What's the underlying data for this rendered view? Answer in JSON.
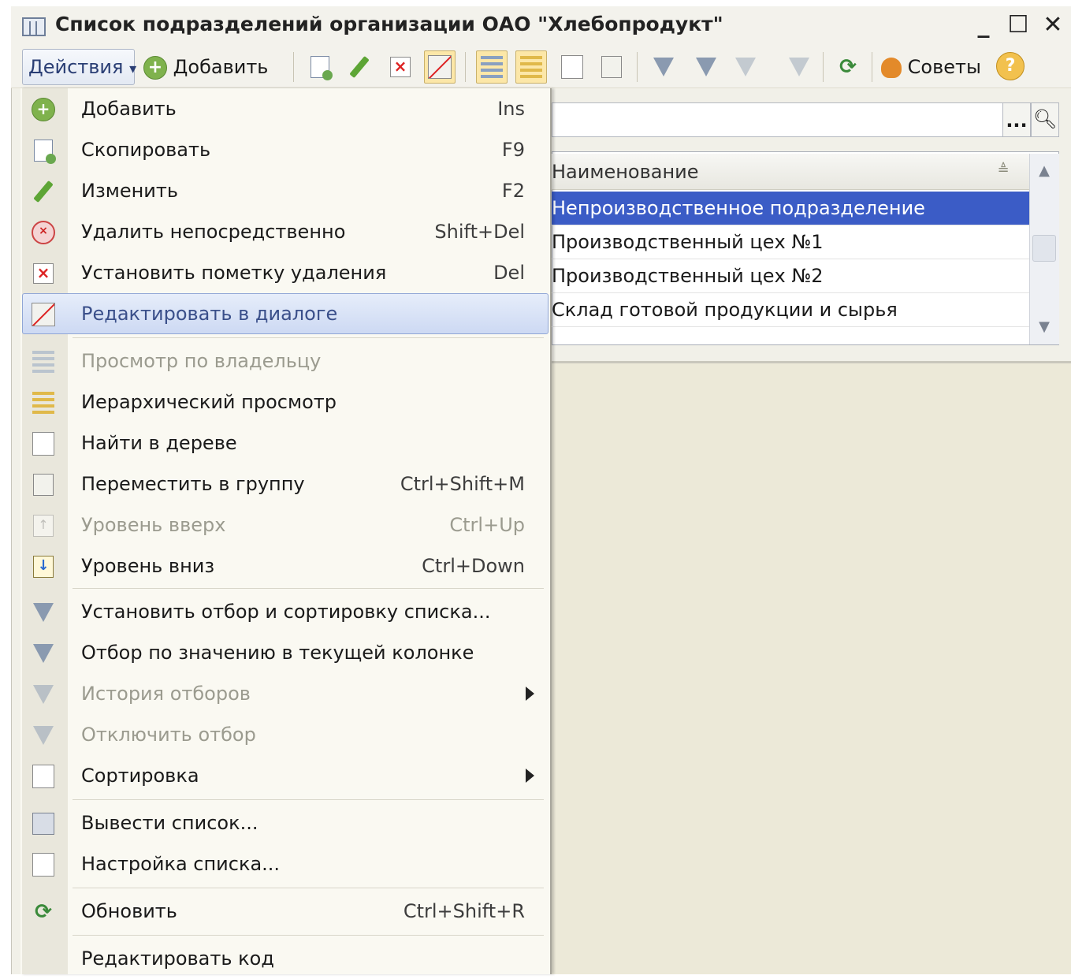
{
  "window": {
    "title": "Список подразделений организации ОАО \"Хлебопродукт\"",
    "minimize": "_",
    "maximize": "☐",
    "close": "✕"
  },
  "toolbar": {
    "actions_label": "Действия",
    "actions_arrow": "▾",
    "add_label": "Добавить",
    "hints_label": "Советы",
    "help_glyph": "?",
    "refresh_glyph": "⟳"
  },
  "search": {
    "value": "",
    "dots": "...",
    "icon": "magnifier-icon"
  },
  "table": {
    "column_header": "Наименование",
    "rows": [
      "Непроизводственное подразделение",
      "Производственный цех №1",
      "Производственный цех №2",
      "Склад готовой продукции и сырья"
    ],
    "selected_index": 0
  },
  "menu": {
    "items": [
      {
        "label": "Добавить",
        "shortcut": "Ins",
        "icon": "add-icon",
        "enabled": true
      },
      {
        "label": "Скопировать",
        "shortcut": "F9",
        "icon": "copy-icon",
        "enabled": true
      },
      {
        "label": "Изменить",
        "shortcut": "F2",
        "icon": "pencil-icon",
        "enabled": true
      },
      {
        "label": "Удалить непосредственно",
        "shortcut": "Shift+Del",
        "icon": "delete-icon",
        "enabled": true
      },
      {
        "label": "Установить пометку удаления",
        "shortcut": "Del",
        "icon": "mark-delete-icon",
        "enabled": true
      },
      {
        "label": "Редактировать в диалоге",
        "shortcut": "",
        "icon": "edit-dialog-icon",
        "enabled": true,
        "highlighted": true
      },
      {
        "label": "Просмотр по владельцу",
        "shortcut": "",
        "icon": "owner-view-icon",
        "enabled": false
      },
      {
        "label": "Иерархический просмотр",
        "shortcut": "",
        "icon": "hierarchy-icon",
        "enabled": true
      },
      {
        "label": "Найти в дереве",
        "shortcut": "",
        "icon": "find-tree-icon",
        "enabled": true
      },
      {
        "label": "Переместить в группу",
        "shortcut": "Ctrl+Shift+M",
        "icon": "move-group-icon",
        "enabled": true
      },
      {
        "label": "Уровень вверх",
        "shortcut": "Ctrl+Up",
        "icon": "level-up-icon",
        "enabled": false
      },
      {
        "label": "Уровень вниз",
        "shortcut": "Ctrl+Down",
        "icon": "level-down-icon",
        "enabled": true
      },
      {
        "label": "Установить отбор и сортировку списка...",
        "shortcut": "",
        "icon": "filter-sort-icon",
        "enabled": true
      },
      {
        "label": "Отбор по значению в текущей колонке",
        "shortcut": "",
        "icon": "filter-value-icon",
        "enabled": true
      },
      {
        "label": "История отборов",
        "shortcut": "",
        "icon": "filter-history-icon",
        "enabled": false,
        "submenu": true
      },
      {
        "label": "Отключить отбор",
        "shortcut": "",
        "icon": "filter-off-icon",
        "enabled": false
      },
      {
        "label": "Сортировка",
        "shortcut": "",
        "icon": "sort-icon",
        "enabled": true,
        "submenu": true
      },
      {
        "label": "Вывести список...",
        "shortcut": "",
        "icon": "print-list-icon",
        "enabled": true
      },
      {
        "label": "Настройка списка...",
        "shortcut": "",
        "icon": "list-settings-icon",
        "enabled": true
      },
      {
        "label": "Обновить",
        "shortcut": "Ctrl+Shift+R",
        "icon": "refresh-icon",
        "enabled": true
      },
      {
        "label": "Редактировать код",
        "shortcut": "",
        "icon": "",
        "enabled": true
      }
    ]
  },
  "colors": {
    "selection": "#3b5cc6",
    "menu_highlight": "#cdd9f3",
    "window_bg": "#f1f0e8"
  }
}
